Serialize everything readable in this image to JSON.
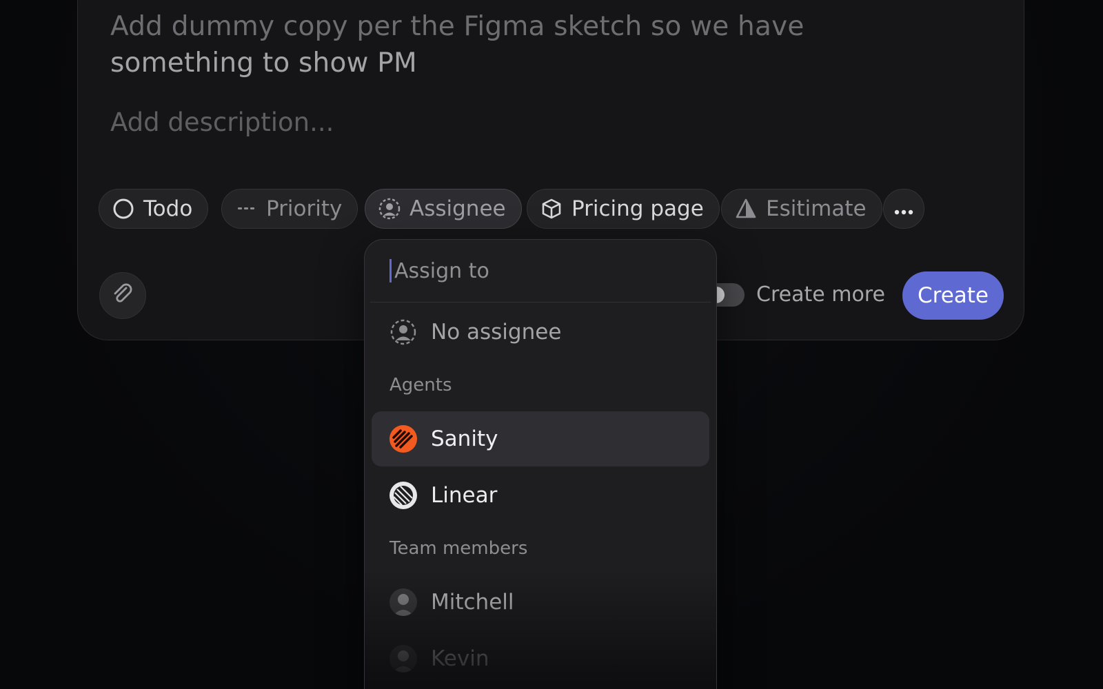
{
  "issue": {
    "title_line1": "Add dummy copy per the Figma sketch so we have",
    "title_line2": "something to show PM",
    "description_placeholder": "Add description..."
  },
  "chips": {
    "status": "Todo",
    "priority": "Priority",
    "assignee": "Assignee",
    "project": "Pricing page",
    "estimate": "Esitimate",
    "more_icon": "ellipsis-icon"
  },
  "footer": {
    "create_more_label": "Create more",
    "create_more_enabled": false,
    "create_label": "Create"
  },
  "assign_menu": {
    "search_placeholder": "Assign to",
    "no_assignee": "No assignee",
    "agents_label": "Agents",
    "agents": [
      {
        "name": "Sanity",
        "highlighted": true,
        "avatar_color": "#f25a1f"
      },
      {
        "name": "Linear",
        "highlighted": false,
        "avatar_color": "#e8e8ea"
      }
    ],
    "team_label": "Team members",
    "team": [
      {
        "name": "Mitchell"
      },
      {
        "name": "Kevin"
      }
    ]
  },
  "colors": {
    "accent": "#5e6ad2",
    "background": "#07080a",
    "card": "#151517"
  }
}
